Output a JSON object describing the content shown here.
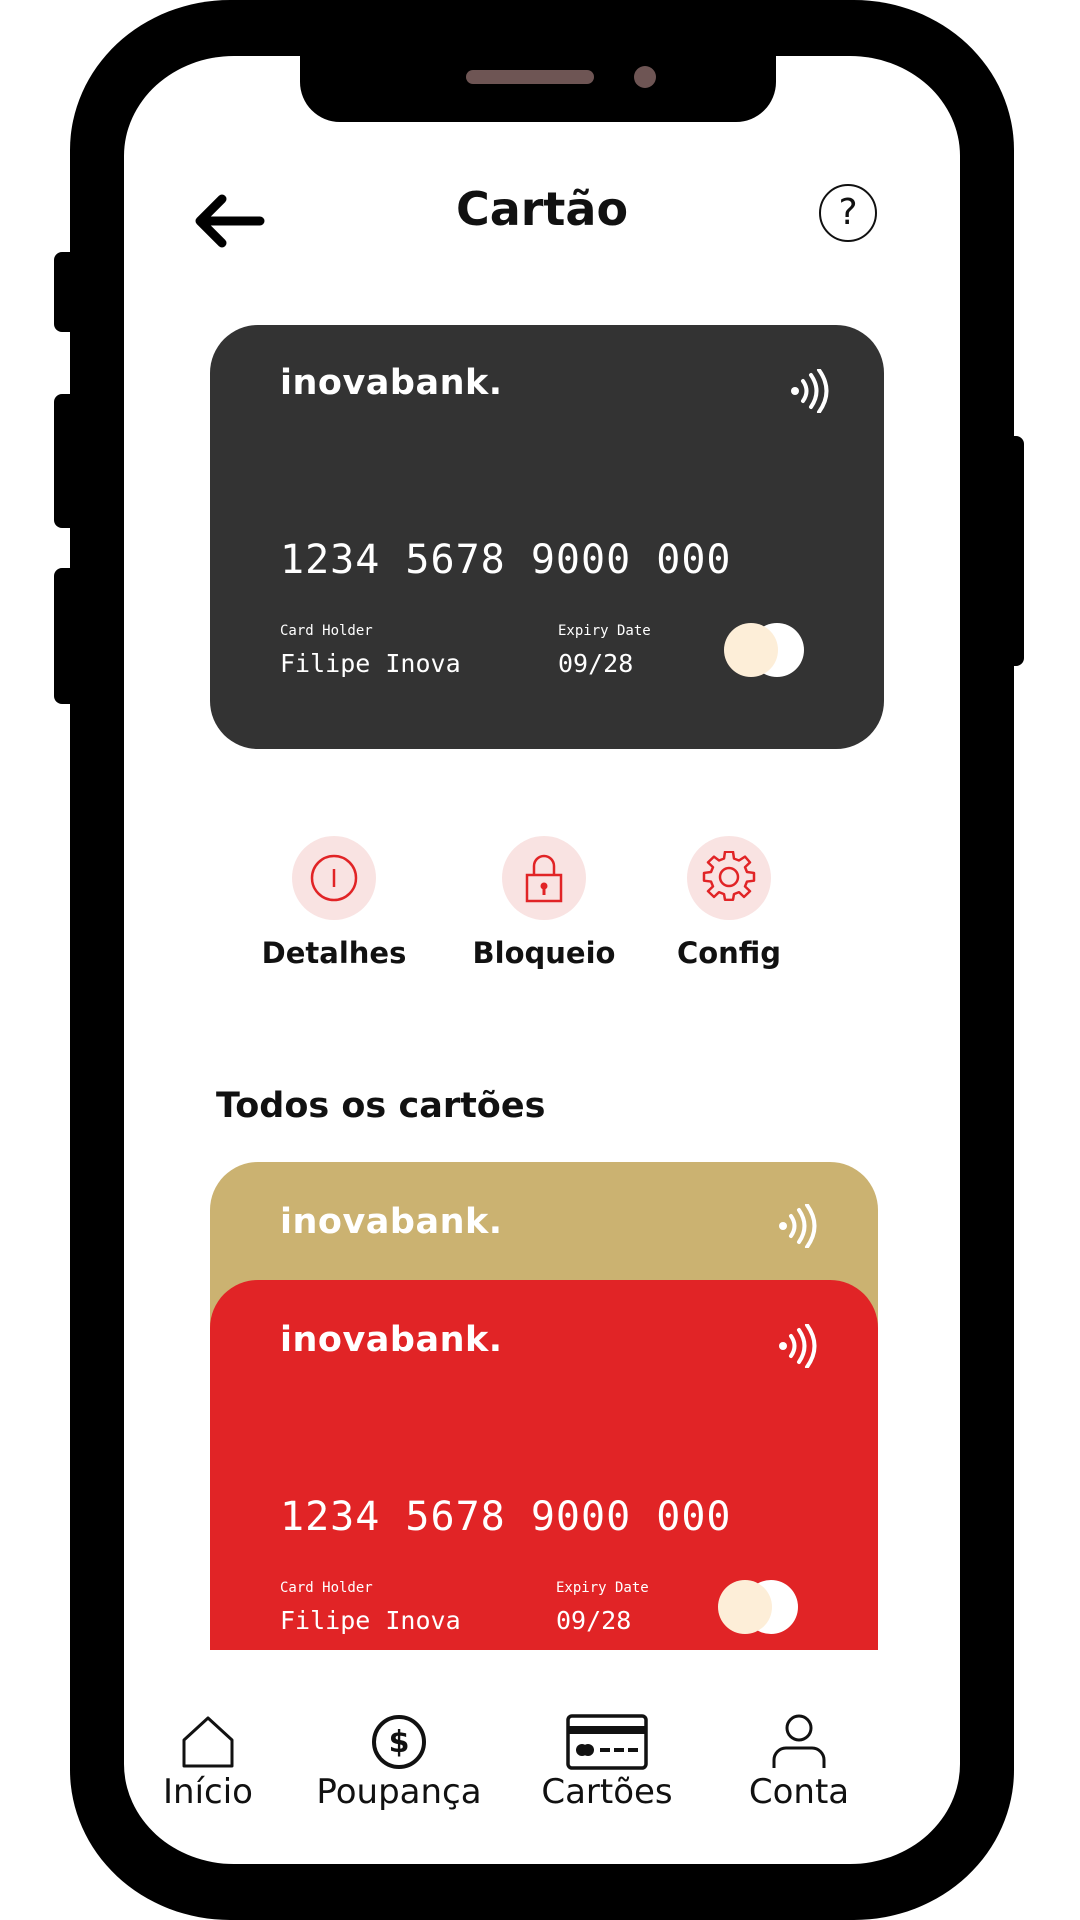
{
  "header": {
    "title": "Cartão",
    "back_icon": "arrow-left-icon",
    "help_label": "?"
  },
  "main_card": {
    "brand": "inovabank.",
    "number": "1234 5678 9000 000",
    "holder_label": "Card Holder",
    "holder_name": "Filipe Inova",
    "expiry_label": "Expiry Date",
    "expiry": "09/28",
    "color": "#333333"
  },
  "actions": [
    {
      "label": "Detalhes",
      "icon": "info-icon"
    },
    {
      "label": "Bloqueio",
      "icon": "lock-icon"
    },
    {
      "label": "Config",
      "icon": "gear-icon"
    }
  ],
  "cards_section": {
    "title": "Todos os cartões",
    "gold_card": {
      "brand": "inovabank.",
      "color": "#cbb271"
    },
    "red_card": {
      "brand": "inovabank.",
      "number": "1234 5678 9000 000",
      "holder_label": "Card Holder",
      "holder_name": "Filipe Inova",
      "expiry_label": "Expiry Date",
      "expiry": "09/28",
      "color": "#e12426"
    }
  },
  "nav": [
    {
      "label": "Início",
      "icon": "home-icon"
    },
    {
      "label": "Poupança",
      "icon": "dollar-icon"
    },
    {
      "label": "Cartões",
      "icon": "credit-card-icon"
    },
    {
      "label": "Conta",
      "icon": "user-icon"
    }
  ],
  "colors": {
    "accent": "#e12426",
    "accent_light": "#f9e3e2",
    "gold": "#cbb271",
    "dark_card": "#333333"
  }
}
